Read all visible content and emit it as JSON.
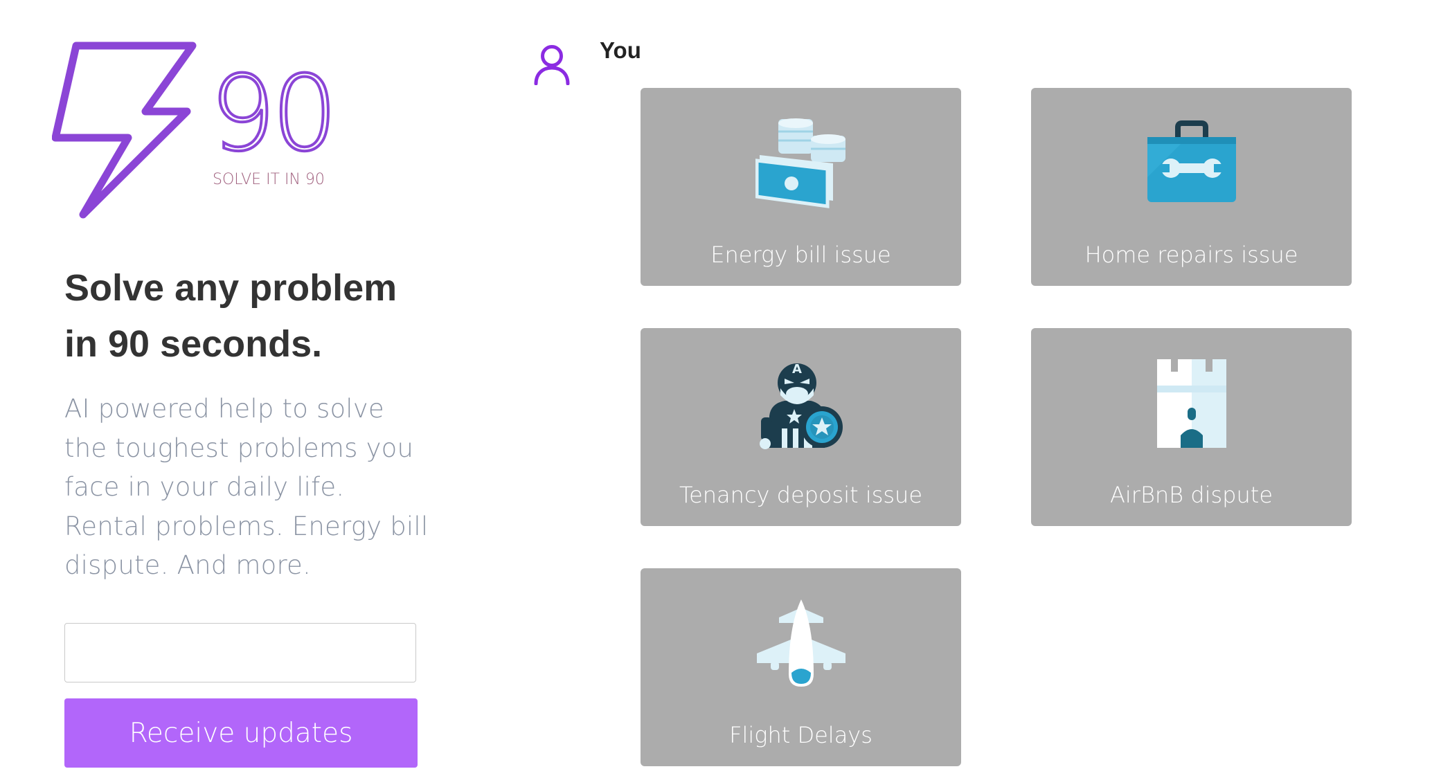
{
  "brand": {
    "logo_number": "90",
    "logo_tagline": "SOLVE IT IN 90",
    "primary_color": "#8b45d6",
    "tagline_color": "#a0607e"
  },
  "hero": {
    "headline_line1": "Solve any problem",
    "headline_line2": "in 90 seconds.",
    "description": "AI powered help to solve the toughest problems you face in your daily life. Rental problems. Energy bill dispute. And more."
  },
  "signup": {
    "email_value": "",
    "button_label": "Receive updates",
    "button_color": "#b266fa"
  },
  "user": {
    "name": "You",
    "icon": "user-icon"
  },
  "categories": [
    {
      "label": "Energy bill issue",
      "icon": "money-icon"
    },
    {
      "label": "Home repairs issue",
      "icon": "toolbox-icon"
    },
    {
      "label": "Tenancy deposit issue",
      "icon": "superhero-icon"
    },
    {
      "label": "AirBnB dispute",
      "icon": "castle-icon"
    },
    {
      "label": "Flight Delays",
      "icon": "airplane-icon"
    }
  ],
  "colors": {
    "card_background": "#acacac",
    "icon_dark": "#1c3d4d",
    "icon_blue": "#2aa4cf",
    "icon_light": "#ddf1f8"
  }
}
